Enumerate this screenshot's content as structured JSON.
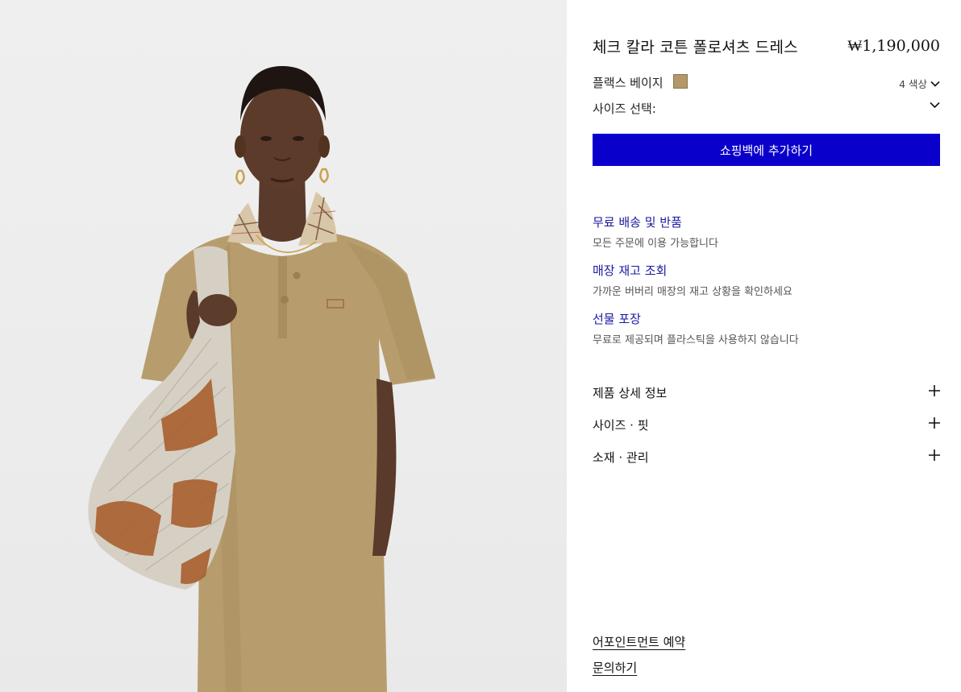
{
  "product": {
    "title": "체크 칼라 코튼 폴로셔츠 드레스",
    "price": "₩1,190,000"
  },
  "color": {
    "name": "플랙스 베이지",
    "swatch_hex": "#b39869",
    "count_label": "4 색상",
    "icon": "chevron-down-icon"
  },
  "size": {
    "label": "사이즈 선택:",
    "icon": "chevron-down-icon"
  },
  "cta": {
    "label": "쇼핑백에 추가하기",
    "color": "#0a00cc"
  },
  "services": [
    {
      "title": "무료 배송 및 반품",
      "desc": "모든 주문에 이용 가능합니다"
    },
    {
      "title": "매장 재고 조회",
      "desc": "가까운 버버리 매장의 재고 상황을 확인하세요"
    },
    {
      "title": "선물 포장",
      "desc": "무료로 제공되며 플라스틱을 사용하지 않습니다"
    }
  ],
  "accordions": [
    {
      "label": "제품 상세 정보",
      "icon": "plus-icon"
    },
    {
      "label": "사이즈 · 핏",
      "icon": "plus-icon"
    },
    {
      "label": "소재 · 관리",
      "icon": "plus-icon"
    }
  ],
  "footer_links": [
    {
      "label": "어포인트먼트 예약"
    },
    {
      "label": "문의하기"
    }
  ]
}
